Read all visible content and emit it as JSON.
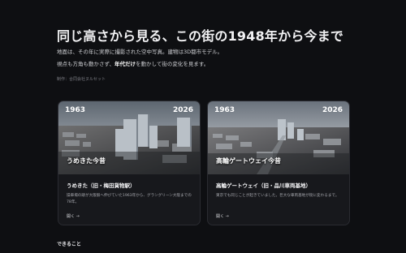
{
  "header": {
    "title": "同じ高さから見る、この街の1948年から今まで",
    "desc_line1": "地面は、その年に実際に撮影された空中写真。建物は3D都市モデル。",
    "desc_line2_pre": "視点も方角も動かさず、",
    "desc_line2_bold": "年代だけ",
    "desc_line2_post": "を動かして街の変化を見ます。",
    "credit": "制作：合同会社ヌルセット"
  },
  "cards": [
    {
      "year_start": "1963",
      "year_end": "2026",
      "overlay_label": "うめきた今昔",
      "name": "うめきた（旧・梅田貨物駅）",
      "description": "操車場の跡が大阪駅へ伸びていた1963年から、グラングリーン大阪までの78年。",
      "open_label": "開く →"
    },
    {
      "year_start": "1963",
      "year_end": "2026",
      "overlay_label": "高輪ゲートウェイ今昔",
      "name": "高輪ゲートウェイ（旧・品川車両基地）",
      "description": "東京でも同じことが起きていました。巨大な車両基地が街に変わるまで。",
      "open_label": "開く →"
    }
  ],
  "sections": {
    "next_heading": "できること"
  },
  "colors": {
    "background": "#0e0f12",
    "card_background": "#17181c",
    "text_primary": "#f2f2f4",
    "text_muted": "#a7a8ae"
  }
}
